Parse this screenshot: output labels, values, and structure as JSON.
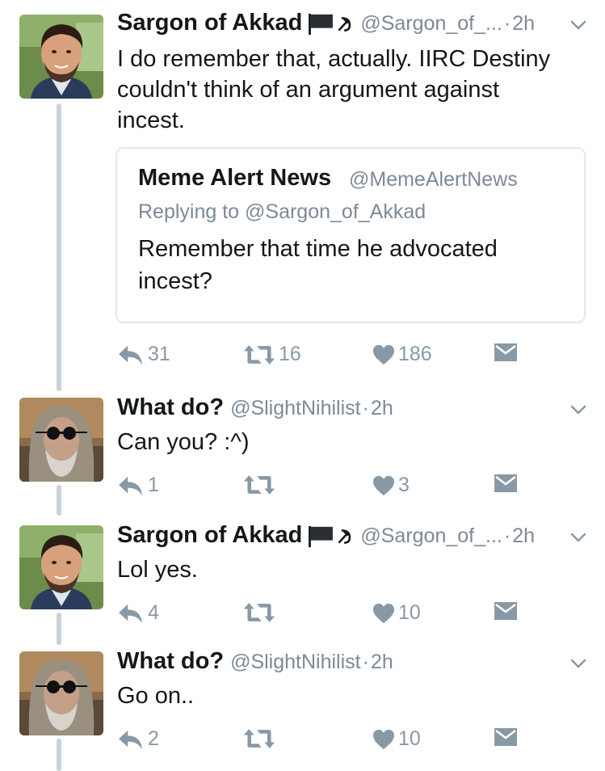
{
  "tweets": [
    {
      "name": "Sargon of Akkad",
      "handle": "@Sargon_of_...",
      "dot": "·",
      "time": "2h",
      "badges": [
        "black-flag-icon",
        "hammer-sickle-icon"
      ],
      "text": "I do remember that, actually. IIRC Destiny couldn't think of an argument against incest.",
      "quoted": {
        "name": "Meme Alert News",
        "handle": "@MemeAlertNews",
        "reply": "Replying to @Sargon_of_Akkad",
        "text": "Remember that time he advocated incest?"
      },
      "reply_count": "31",
      "retweet_count": "16",
      "like_count": "186"
    },
    {
      "name": "What do?",
      "handle": "@SlightNihilist",
      "dot": "·",
      "time": "2h",
      "text": "Can you? :^)",
      "reply_count": "1",
      "retweet_count": "",
      "like_count": "3"
    },
    {
      "name": "Sargon of Akkad",
      "handle": "@Sargon_of_...",
      "dot": "·",
      "time": "2h",
      "badges": [
        "black-flag-icon",
        "hammer-sickle-icon"
      ],
      "text": "Lol yes.",
      "reply_count": "4",
      "retweet_count": "",
      "like_count": "10"
    },
    {
      "name": "What do?",
      "handle": "@SlightNihilist",
      "dot": "·",
      "time": "2h",
      "text": "Go on..",
      "reply_count": "2",
      "retweet_count": "",
      "like_count": "10"
    }
  ],
  "colors": {
    "text": "#14171a",
    "secondary": "#7d8a96",
    "icon": "#8899a6",
    "thread_line": "#c7d3dc",
    "border": "#e1e8ed"
  }
}
